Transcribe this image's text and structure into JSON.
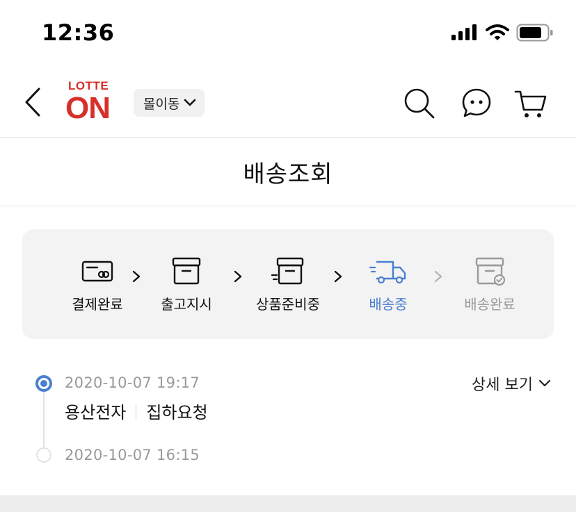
{
  "status_bar": {
    "time": "12:36"
  },
  "header": {
    "logo_top": "LOTTE",
    "logo_main": "ON",
    "mall_selector_label": "몰이동",
    "brand_color": "#d7302a"
  },
  "page": {
    "title": "배송조회"
  },
  "steps": [
    {
      "label": "결제완료",
      "icon": "card-icon",
      "state": "done"
    },
    {
      "label": "출고지시",
      "icon": "box-icon",
      "state": "done"
    },
    {
      "label": "상품준비중",
      "icon": "box-moving-icon",
      "state": "done"
    },
    {
      "label": "배송중",
      "icon": "truck-icon",
      "state": "current"
    },
    {
      "label": "배송완료",
      "icon": "box-check-icon",
      "state": "upcoming"
    }
  ],
  "colors": {
    "active": "#4a7fd1",
    "inactive": "#9a9a9a"
  },
  "tracking": {
    "detail_toggle_label": "상세 보기",
    "events": [
      {
        "time": "2020-10-07 19:17",
        "location": "용산전자",
        "status": "집하요청"
      },
      {
        "time": "2020-10-07 16:15"
      }
    ]
  }
}
